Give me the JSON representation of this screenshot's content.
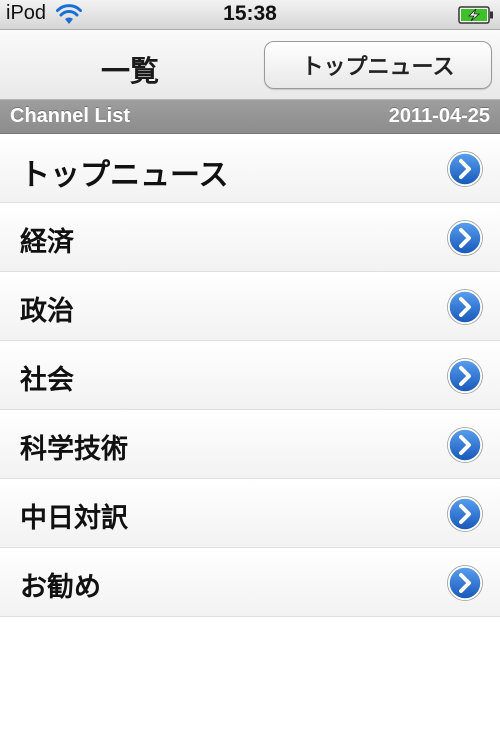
{
  "status_bar": {
    "carrier": "iPod",
    "time": "15:38",
    "wifi_icon": "wifi-icon",
    "battery_icon": "battery-charging-icon",
    "battery_color": "#3fbf2a"
  },
  "nav_bar": {
    "title": "一覧",
    "right_button_label": "トップニュース"
  },
  "section": {
    "title": "Channel List",
    "date": "2011-04-25"
  },
  "channels": [
    {
      "label": "トップニュース"
    },
    {
      "label": "経済"
    },
    {
      "label": "政治"
    },
    {
      "label": "社会"
    },
    {
      "label": "科学技術"
    },
    {
      "label": "中日対訳"
    },
    {
      "label": "お勧め"
    }
  ],
  "colors": {
    "accent_blue": "#1d6fd6",
    "section_header": "#959595"
  },
  "disclosure_icon": "chevron-right-circle-icon"
}
